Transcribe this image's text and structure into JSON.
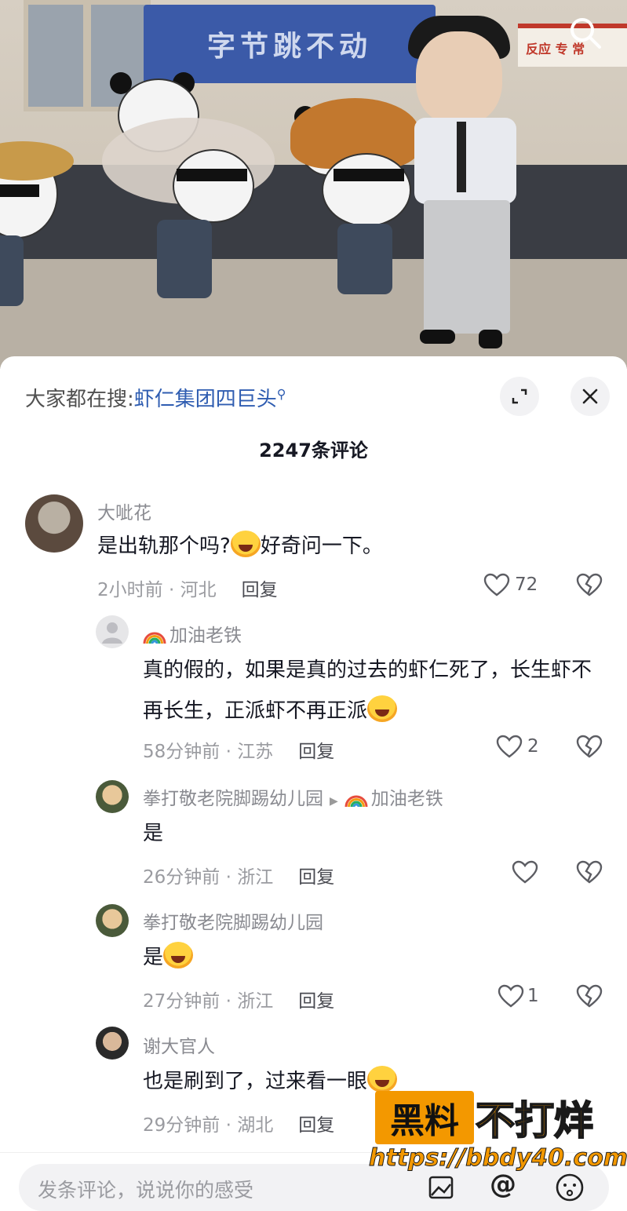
{
  "video": {
    "sign_text": "字节跳不动",
    "right_sign_text": "反应  专 常"
  },
  "header": {
    "hot_search_label": "大家都在搜:",
    "hot_search_keyword": "虾仁集团四巨头",
    "comment_count": "2247条评论"
  },
  "comments": [
    {
      "username": "大呲花",
      "text": "是出轨那个吗?",
      "text_after_emoji": "好奇问一下。",
      "time_location": "2小时前 · 河北",
      "reply_label": "回复",
      "likes": "72"
    },
    {
      "username": "加油老铁",
      "text": "真的假的，如果是真的过去的虾仁死了，长生虾不再长生，正派虾不再正派",
      "time_location": "58分钟前 · 江苏",
      "reply_label": "回复",
      "likes": "2"
    },
    {
      "username": "拳打敬老院脚踢幼儿园",
      "reply_to": "加油老铁",
      "text": "是",
      "time_location": "26分钟前 · 浙江",
      "reply_label": "回复",
      "likes": ""
    },
    {
      "username": "拳打敬老院脚踢幼儿园",
      "text": "是",
      "time_location": "27分钟前 · 浙江",
      "reply_label": "回复",
      "likes": "1"
    },
    {
      "username": "谢大官人",
      "text": "也是刷到了，过来看一眼",
      "time_location": "29分钟前 · 湖北",
      "reply_label": "回复",
      "likes": ""
    }
  ],
  "bottom": {
    "input_placeholder": "发条评论，说说你的感受"
  },
  "watermark": {
    "box_text": "黑料",
    "text": "不打烊",
    "url": "https://bbdy40.com"
  },
  "colors": {
    "link_blue": "#2f5db1",
    "watermark_orange": "#f39800",
    "sign_blue": "#3b5aa8"
  }
}
